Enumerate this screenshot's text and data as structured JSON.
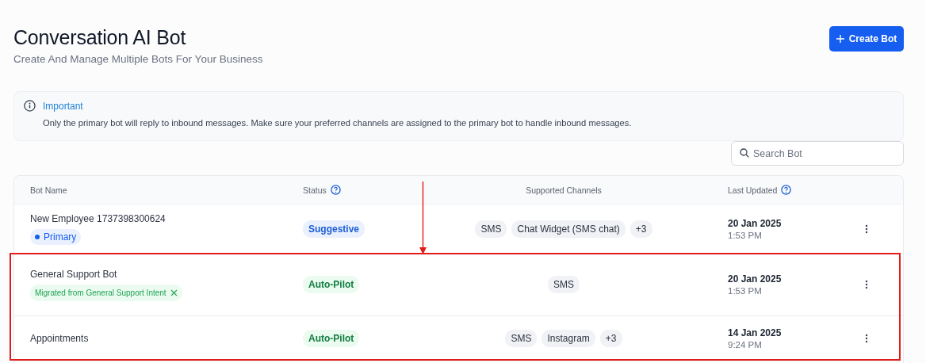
{
  "header": {
    "title": "Conversation AI Bot",
    "subtitle": "Create And Manage Multiple Bots For Your Business",
    "create_button": "Create Bot"
  },
  "alert": {
    "title": "Important",
    "message": "Only the primary bot will reply to inbound messages. Make sure your preferred channels are assigned to the primary bot to handle inbound messages."
  },
  "search": {
    "placeholder": "Search Bot"
  },
  "table": {
    "columns": [
      {
        "label": "Bot Name",
        "help": false
      },
      {
        "label": "Status",
        "help": true
      },
      {
        "label": "Supported Channels",
        "help": false
      },
      {
        "label": "Last Updated",
        "help": true
      }
    ],
    "rows": [
      {
        "name": "New Employee 1737398300624",
        "tag": {
          "kind": "primary",
          "label": "Primary"
        },
        "status": {
          "kind": "suggestive",
          "label": "Suggestive"
        },
        "channels": [
          "SMS",
          "Chat Widget (SMS chat)",
          "+3"
        ],
        "date": "20 Jan 2025",
        "time": "1:53 PM"
      },
      {
        "name": "General Support Bot",
        "tag": {
          "kind": "migrated",
          "label": "Migrated from General Support Intent"
        },
        "status": {
          "kind": "autopilot",
          "label": "Auto-Pilot"
        },
        "channels": [
          "SMS"
        ],
        "date": "20 Jan 2025",
        "time": "1:53 PM"
      },
      {
        "name": "Appointments",
        "status": {
          "kind": "autopilot",
          "label": "Auto-Pilot"
        },
        "channels": [
          "SMS",
          "Instagram",
          "+3"
        ],
        "date": "14 Jan 2025",
        "time": "9:24 PM"
      }
    ]
  },
  "annotations": {
    "arrow": true,
    "highlight_box": true
  }
}
